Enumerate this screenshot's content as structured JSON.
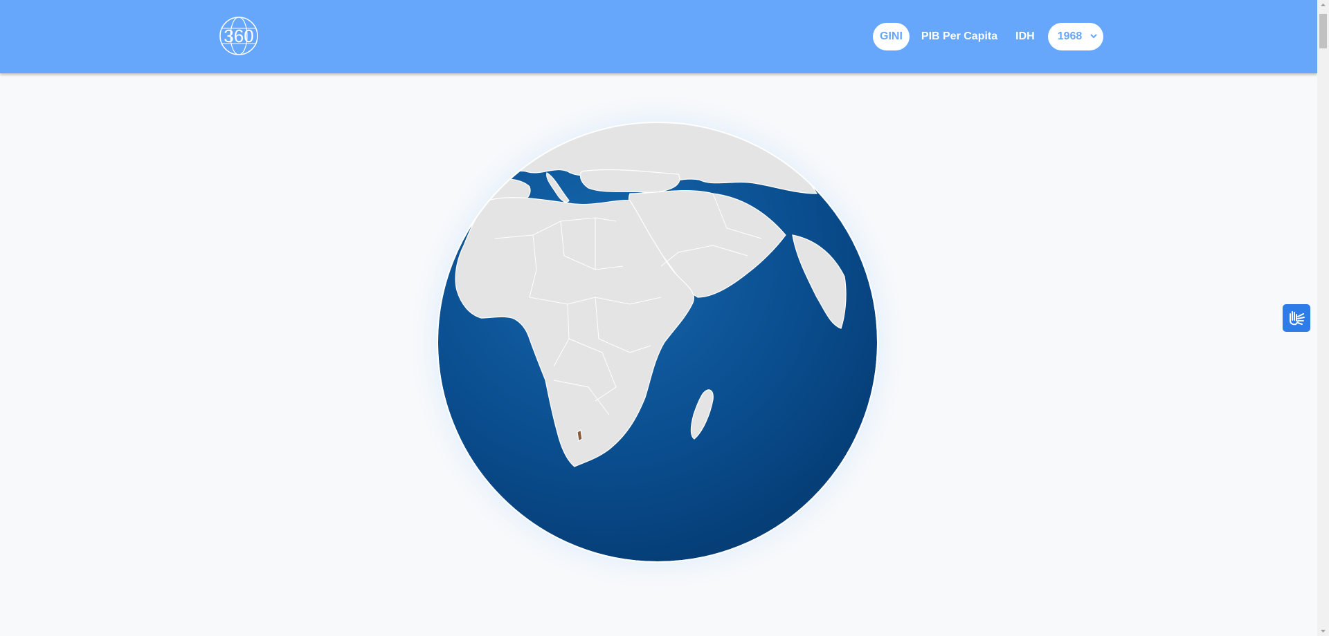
{
  "header": {
    "logo_icon": "globe-360-logo-icon",
    "logo_text": "360",
    "nav": [
      {
        "label": "GINI",
        "active": true
      },
      {
        "label": "PIB Per Capita",
        "active": false
      },
      {
        "label": "IDH",
        "active": false
      }
    ],
    "year_select": {
      "selected": "1968",
      "icon": "chevron-down-icon"
    }
  },
  "globe": {
    "ocean_color": "#0a4a8a",
    "land_color": "#e4e4e4",
    "border_color": "#ffffff",
    "highlight_colors": [
      "#4b1b7a",
      "#8a5a3a"
    ]
  },
  "accessibility": {
    "icon": "sign-language-hands-icon",
    "color": "#2e7ce8"
  },
  "colors": {
    "header_bg": "#66a6fb",
    "page_bg": "#f7f9fb"
  }
}
